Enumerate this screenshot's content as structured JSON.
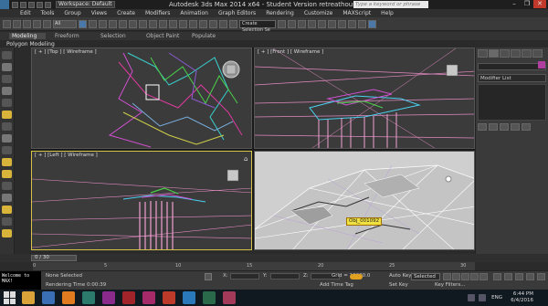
{
  "window": {
    "workspace": "Workspace: Default",
    "title": "Autodesk 3ds Max  2014 x64   - Student Version    retreathouse_vray.max",
    "search_placeholder": "Type a keyword or phrase",
    "controls": [
      "–",
      "❐",
      "✕"
    ]
  },
  "menu": [
    "Edit",
    "Tools",
    "Group",
    "Views",
    "Create",
    "Modifiers",
    "Animation",
    "Graph Editors",
    "Rendering",
    "Customize",
    "MAXScript",
    "Help"
  ],
  "toolbar": {
    "selection_filter": "All",
    "named_selection": "Create Selection Se"
  },
  "ribbon": {
    "tabs": [
      "Modeling",
      "Freeform",
      "Selection",
      "Object Paint",
      "Populate"
    ],
    "active_tab": "Modeling",
    "sub_label": "Polygon Modeling"
  },
  "viewports": {
    "top": {
      "label": "[ + ] [Top ] [ Wireframe ]"
    },
    "front": {
      "label": "[ + ] [Front ] [ Wireframe ]"
    },
    "left": {
      "label": "[ + ] [Left ] [ Wireframe ]"
    },
    "perspective": {
      "label": "",
      "object_tag": "Obj_001092"
    }
  },
  "command_panel": {
    "modifier_list": "Modifier List"
  },
  "timeline": {
    "frame": "0 / 30",
    "ticks": [
      "0",
      "5",
      "10",
      "15",
      "20",
      "25",
      "30"
    ]
  },
  "status": {
    "maxscript": "Welcome to MAX!",
    "selection": "None Selected",
    "render_time": "Rendering Time  0:00:39",
    "x_label": "X:",
    "y_label": "Y:",
    "z_label": "Z:",
    "grid": "Grid = 10000.0",
    "add_time_tag": "Add Time Tag",
    "auto_key": "Auto Key",
    "auto_key_mode": "Selected",
    "set_key": "Set Key",
    "key_filters": "Key Filters..."
  },
  "taskbar": {
    "time": "6:44 PM",
    "date": "6/4/2016",
    "language": "ENG",
    "app_colors": [
      "#d9a33a",
      "#3b6fb5",
      "#e07b1f",
      "#2b7a6b",
      "#8a2a8a",
      "#a0242a",
      "#a42a6a",
      "#bb3a2a",
      "#2a7abb",
      "#2a6a4a",
      "#a33a5a"
    ]
  },
  "colors": {
    "active_viewport_border": "#d6c34a",
    "object_color": "#b040a0",
    "close_button": "#c0392b"
  }
}
